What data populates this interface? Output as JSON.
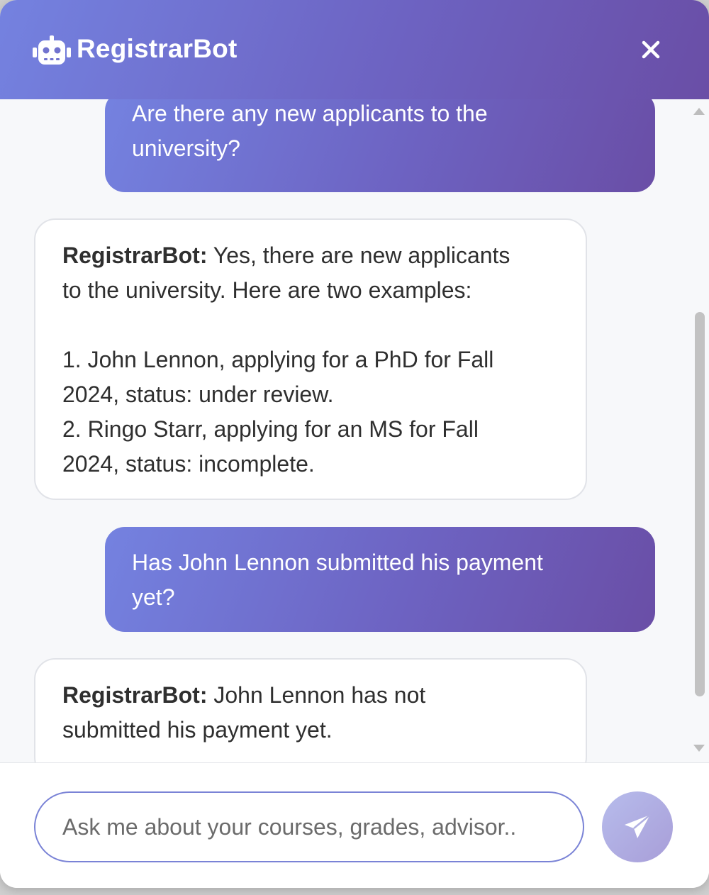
{
  "header": {
    "title": "RegistrarBot",
    "bot_icon": "robot-icon",
    "close_icon": "close-icon"
  },
  "messages": [
    {
      "role": "user",
      "lines": [
        "Are there any new applicants to the",
        "university?"
      ]
    },
    {
      "role": "bot",
      "sender": "RegistrarBot:",
      "first_line_rest": " Yes, there are new applicants",
      "lines": [
        "to the university. Here are two examples:",
        "",
        "1. John Lennon, applying for a PhD for Fall",
        "2024, status: under review.",
        "2. Ringo Starr, applying for an MS for Fall",
        "2024, status: incomplete."
      ]
    },
    {
      "role": "user",
      "lines": [
        "Has John Lennon submitted his payment",
        "yet?"
      ]
    },
    {
      "role": "bot",
      "sender": "RegistrarBot:",
      "first_line_rest": " John Lennon has not",
      "lines": [
        "submitted his payment yet."
      ]
    }
  ],
  "composer": {
    "placeholder": "Ask me about your courses, grades, advisor..",
    "send_icon": "send-icon"
  },
  "colors": {
    "header_gradient_start": "#7482e0",
    "header_gradient_end": "#6a4ea6",
    "page_background": "#f7f8fa",
    "input_border": "#7a83d6"
  }
}
